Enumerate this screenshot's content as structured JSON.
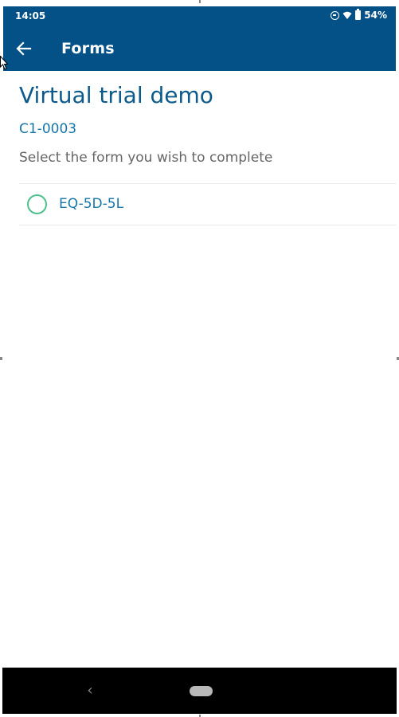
{
  "status_bar": {
    "time": "14:05",
    "battery": "54%",
    "icons": [
      "do-not-disturb-icon",
      "wifi-icon",
      "battery-icon"
    ]
  },
  "app_bar": {
    "title": "Forms",
    "back_icon": "arrow-left-icon"
  },
  "page": {
    "title": "Virtual trial demo",
    "subject_id": "C1-0003",
    "instruction": "Select the form you wish to complete",
    "forms": [
      {
        "label": "EQ-5D-5L",
        "selected": false
      }
    ]
  },
  "nav_bar": {
    "icons": [
      "nav-back-icon",
      "nav-home-pill"
    ],
    "back_glyph": "‹"
  },
  "colors": {
    "primary": "#035186",
    "title": "#0c5a8b",
    "accent_text": "#1776a8",
    "radio": "#4ec08e",
    "muted_text": "#666666"
  }
}
